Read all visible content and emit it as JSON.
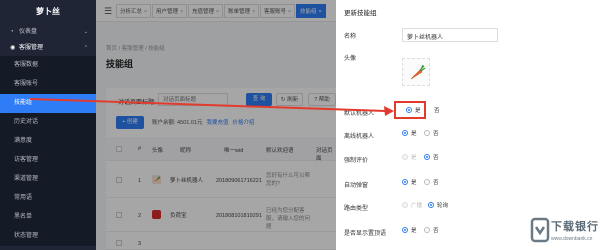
{
  "sidebar": {
    "logo": "萝卜丝",
    "items": [
      {
        "label": "仪表盘"
      },
      {
        "label": "客服管理"
      }
    ],
    "sub_items": [
      {
        "label": "客服数据"
      },
      {
        "label": "客服账号"
      },
      {
        "label": "技能组"
      },
      {
        "label": "历史对话"
      },
      {
        "label": "满意度"
      },
      {
        "label": "访客管理"
      },
      {
        "label": "渠道管理"
      },
      {
        "label": "常用语"
      },
      {
        "label": "黑名单"
      },
      {
        "label": "状态管理"
      }
    ]
  },
  "tabs": [
    {
      "label": "分析汇总"
    },
    {
      "label": "用户管理"
    },
    {
      "label": "充值管理"
    },
    {
      "label": "账单管理"
    },
    {
      "label": "客服账号"
    },
    {
      "label": "技能组"
    }
  ],
  "breadcrumb": "首页  /  客服管理  /  技能组",
  "page_title": "技能组",
  "filter": {
    "label": "对话页面标题:",
    "placeholder": "对话页面标题",
    "query_btn": "查 询",
    "reset_btn": "刷新",
    "help_btn": "帮助"
  },
  "toolbar": {
    "add_btn": "+ 创建",
    "balance": "账户余额: 4501.01元",
    "recharge_link": "我要充值",
    "price_link": "价格介绍"
  },
  "table": {
    "headers": [
      "#",
      "头像",
      "昵称",
      "唯一wid",
      "默认欢迎语",
      "对话页面"
    ],
    "rows": [
      {
        "index": "1",
        "nickname": "萝卜丝机器人",
        "wid": "201809061716221",
        "welcome": "您好有什么可以帮您的?"
      },
      {
        "index": "2",
        "nickname": "负荷宝",
        "wid": "201808101819291",
        "welcome": "已经为您分配客服，请输入您的问题"
      },
      {
        "index": "3",
        "nickname": "",
        "wid": "",
        "welcome": ""
      }
    ]
  },
  "drawer": {
    "title": "更新技能组",
    "fields": {
      "name_label": "名称",
      "name_value": "萝卜丝机器人",
      "avatar_label": "头像",
      "default_robot_label": "默认机器人",
      "offline_robot_label": "离线机器人",
      "forced_rating_label": "强制评价",
      "auto_popup_label": "自动弹窗",
      "route_type_label": "路由类型",
      "show_top_label": "是否显示置顶语"
    },
    "options": {
      "yes": "是",
      "no": "否",
      "broadcast": "广播",
      "round_robin": "轮询"
    }
  },
  "watermark": {
    "title": "下载银行",
    "url": "www.downbank.cn"
  },
  "colors": {
    "primary": "#2f7df6",
    "sidebar_bg": "#1f2535",
    "highlight": "#e23b2e"
  }
}
